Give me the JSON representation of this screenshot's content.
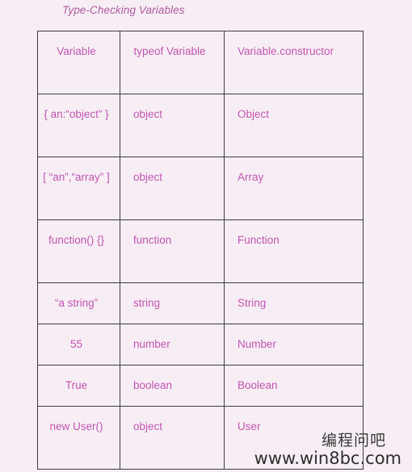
{
  "page": {
    "title": "Type-Checking Variables",
    "background_color": "#f7eef5",
    "text_color": "#c255b0",
    "title_color": "#b05aa0",
    "border_color": "#3c3c3c"
  },
  "table": {
    "headers": [
      "Variable",
      "typeof Variable",
      "Variable.constructor"
    ],
    "rows": [
      {
        "variable": "{ an:“object” }",
        "typeof": "object",
        "constructor": "Object",
        "tall": true
      },
      {
        "variable": "[ “an”,“array” ]",
        "typeof": "object",
        "constructor": "Array",
        "tall": true
      },
      {
        "variable": "function() {}",
        "typeof": "function",
        "constructor": "Function",
        "tall": true
      },
      {
        "variable": "“a string”",
        "typeof": "string",
        "constructor": "String",
        "tall": false
      },
      {
        "variable": "55",
        "typeof": "number",
        "constructor": "Number",
        "tall": false
      },
      {
        "variable": "True",
        "typeof": "boolean",
        "constructor": "Boolean",
        "tall": false
      },
      {
        "variable": "new User()",
        "typeof": "object",
        "constructor": "User",
        "tall": true
      }
    ]
  },
  "watermark": {
    "chinese": "编程问吧",
    "url": "www.win8bc.com"
  }
}
